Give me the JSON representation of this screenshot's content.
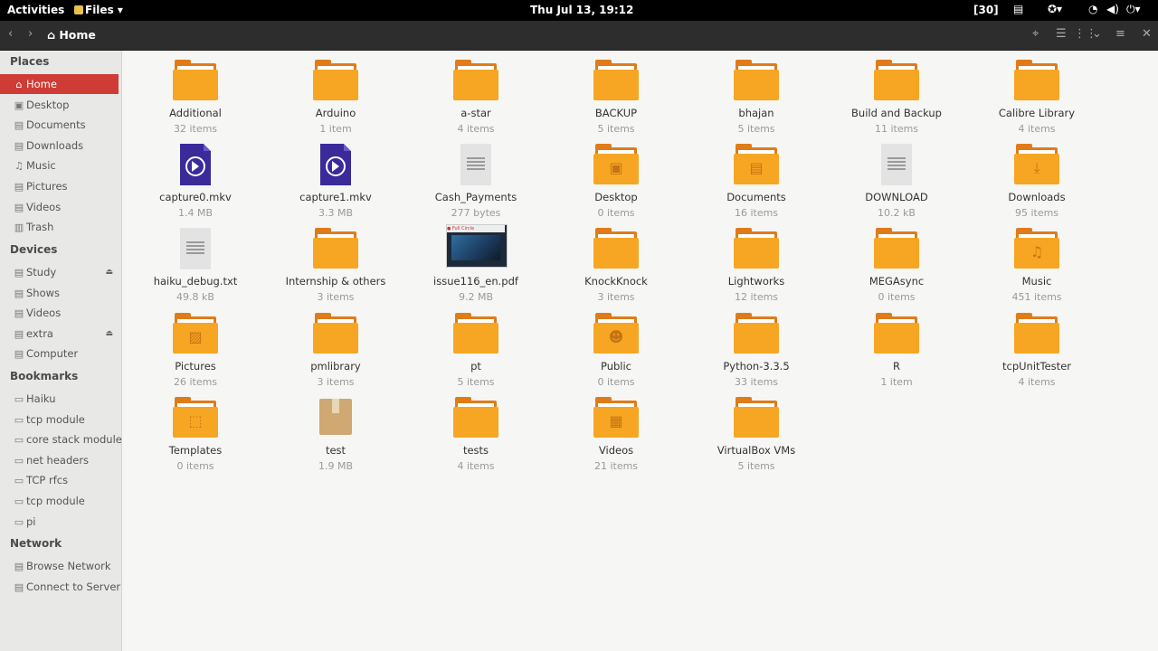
{
  "topbar": {
    "activities": "Activities",
    "app_menu": "Files ▾",
    "clock": "Thu Jul 13, 19:12",
    "badge": "[30]"
  },
  "header": {
    "path": "Home"
  },
  "sidebar": {
    "places_heading": "Places",
    "places": [
      {
        "label": "Home",
        "icon": "home-icon",
        "glyph": "⌂"
      },
      {
        "label": "Desktop",
        "icon": "desktop-icon",
        "glyph": "▣"
      },
      {
        "label": "Documents",
        "icon": "documents-icon",
        "glyph": "▤"
      },
      {
        "label": "Downloads",
        "icon": "downloads-icon",
        "glyph": "▤"
      },
      {
        "label": "Music",
        "icon": "music-icon",
        "glyph": "♫"
      },
      {
        "label": "Pictures",
        "icon": "pictures-icon",
        "glyph": "▤"
      },
      {
        "label": "Videos",
        "icon": "videos-icon",
        "glyph": "▤"
      },
      {
        "label": "Trash",
        "icon": "trash-icon",
        "glyph": "▥"
      }
    ],
    "devices_heading": "Devices",
    "devices": [
      {
        "label": "Study",
        "icon": "drive-icon",
        "glyph": "▤",
        "eject": true
      },
      {
        "label": "Shows",
        "icon": "drive-icon",
        "glyph": "▤",
        "eject": false
      },
      {
        "label": "Videos",
        "icon": "drive-icon",
        "glyph": "▤",
        "eject": false
      },
      {
        "label": "extra",
        "icon": "drive-icon",
        "glyph": "▤",
        "eject": true
      },
      {
        "label": "Computer",
        "icon": "computer-icon",
        "glyph": "▤",
        "eject": false
      }
    ],
    "bookmarks_heading": "Bookmarks",
    "bookmarks": [
      {
        "label": "Haiku",
        "icon": "folder-icon",
        "glyph": "▭"
      },
      {
        "label": "tcp module",
        "icon": "folder-icon",
        "glyph": "▭"
      },
      {
        "label": "core stack module",
        "icon": "folder-icon",
        "glyph": "▭"
      },
      {
        "label": "net headers",
        "icon": "folder-icon",
        "glyph": "▭"
      },
      {
        "label": "TCP rfcs",
        "icon": "folder-icon",
        "glyph": "▭"
      },
      {
        "label": "tcp module",
        "icon": "folder-icon",
        "glyph": "▭"
      },
      {
        "label": "pi",
        "icon": "folder-icon",
        "glyph": "▭"
      }
    ],
    "network_heading": "Network",
    "network": [
      {
        "label": "Browse Network",
        "icon": "network-icon",
        "glyph": "▤"
      },
      {
        "label": "Connect to Server",
        "icon": "server-icon",
        "glyph": "▤"
      }
    ]
  },
  "files": [
    {
      "name": "Additional",
      "meta": "32 items",
      "kind": "folder",
      "emblem": ""
    },
    {
      "name": "Arduino",
      "meta": "1 item",
      "kind": "folder",
      "emblem": ""
    },
    {
      "name": "a-star",
      "meta": "4 items",
      "kind": "folder",
      "emblem": ""
    },
    {
      "name": "BACKUP",
      "meta": "5 items",
      "kind": "folder",
      "emblem": ""
    },
    {
      "name": "bhajan",
      "meta": "5 items",
      "kind": "folder",
      "emblem": ""
    },
    {
      "name": "Build and Backup",
      "meta": "11 items",
      "kind": "folder",
      "emblem": ""
    },
    {
      "name": "Calibre Library",
      "meta": "4 items",
      "kind": "folder",
      "emblem": ""
    },
    {
      "name": "capture0.mkv",
      "meta": "1.4 MB",
      "kind": "video",
      "emblem": ""
    },
    {
      "name": "capture1.mkv",
      "meta": "3.3 MB",
      "kind": "video",
      "emblem": ""
    },
    {
      "name": "Cash_Payments",
      "meta": "277 bytes",
      "kind": "text",
      "emblem": ""
    },
    {
      "name": "Desktop",
      "meta": "0 items",
      "kind": "folder",
      "emblem": "▣"
    },
    {
      "name": "Documents",
      "meta": "16 items",
      "kind": "folder",
      "emblem": "▤"
    },
    {
      "name": "DOWNLOAD",
      "meta": "10.2 kB",
      "kind": "text",
      "emblem": ""
    },
    {
      "name": "Downloads",
      "meta": "95 items",
      "kind": "folder",
      "emblem": "⤓"
    },
    {
      "name": "haiku_debug.txt",
      "meta": "49.8 kB",
      "kind": "text",
      "emblem": ""
    },
    {
      "name": "Internship & others",
      "meta": "3 items",
      "kind": "folder",
      "emblem": ""
    },
    {
      "name": "issue116_en.pdf",
      "meta": "9.2 MB",
      "kind": "pdf",
      "emblem": ""
    },
    {
      "name": "KnockKnock",
      "meta": "3 items",
      "kind": "folder",
      "emblem": ""
    },
    {
      "name": "Lightworks",
      "meta": "12 items",
      "kind": "folder",
      "emblem": ""
    },
    {
      "name": "MEGAsync",
      "meta": "0 items",
      "kind": "folder",
      "emblem": ""
    },
    {
      "name": "Music",
      "meta": "451 items",
      "kind": "folder",
      "emblem": "♫"
    },
    {
      "name": "Pictures",
      "meta": "26 items",
      "kind": "folder",
      "emblem": "▨"
    },
    {
      "name": "pmlibrary",
      "meta": "3 items",
      "kind": "folder",
      "emblem": ""
    },
    {
      "name": "pt",
      "meta": "5 items",
      "kind": "folder",
      "emblem": ""
    },
    {
      "name": "Public",
      "meta": "0 items",
      "kind": "folder",
      "emblem": "☻"
    },
    {
      "name": "Python-3.3.5",
      "meta": "33 items",
      "kind": "folder",
      "emblem": ""
    },
    {
      "name": "R",
      "meta": "1 item",
      "kind": "folder",
      "emblem": ""
    },
    {
      "name": "tcpUnitTester",
      "meta": "4 items",
      "kind": "folder",
      "emblem": ""
    },
    {
      "name": "Templates",
      "meta": "0 items",
      "kind": "folder",
      "emblem": "⬚"
    },
    {
      "name": "test",
      "meta": "1.9 MB",
      "kind": "archive",
      "emblem": ""
    },
    {
      "name": "tests",
      "meta": "4 items",
      "kind": "folder",
      "emblem": ""
    },
    {
      "name": "Videos",
      "meta": "21 items",
      "kind": "folder",
      "emblem": "▦"
    },
    {
      "name": "VirtualBox VMs",
      "meta": "5 items",
      "kind": "folder",
      "emblem": ""
    }
  ],
  "colors": {
    "accent": "#cf3c35",
    "folder": "#f6a622",
    "video": "#3a2a9a"
  }
}
